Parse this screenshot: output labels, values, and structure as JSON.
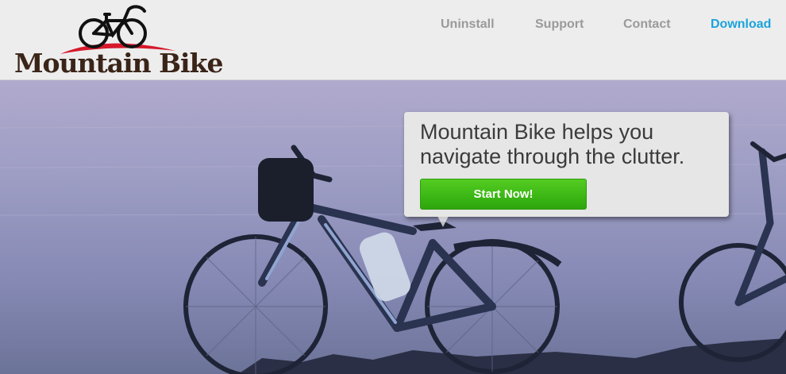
{
  "brand": {
    "name": "Mountain Bike"
  },
  "nav": {
    "items": [
      {
        "label": "Uninstall"
      },
      {
        "label": "Support"
      },
      {
        "label": "Contact"
      },
      {
        "label": "Download",
        "active": true
      }
    ]
  },
  "hero": {
    "headline": "Mountain Bike helps you navigate through the clutter.",
    "cta_label": "Start Now!"
  },
  "colors": {
    "nav_text": "#9a9a9a",
    "nav_active": "#1ba3dc",
    "cta_green": "#3ab614",
    "logo_red": "#d6192b",
    "logo_text": "#3a2418"
  }
}
